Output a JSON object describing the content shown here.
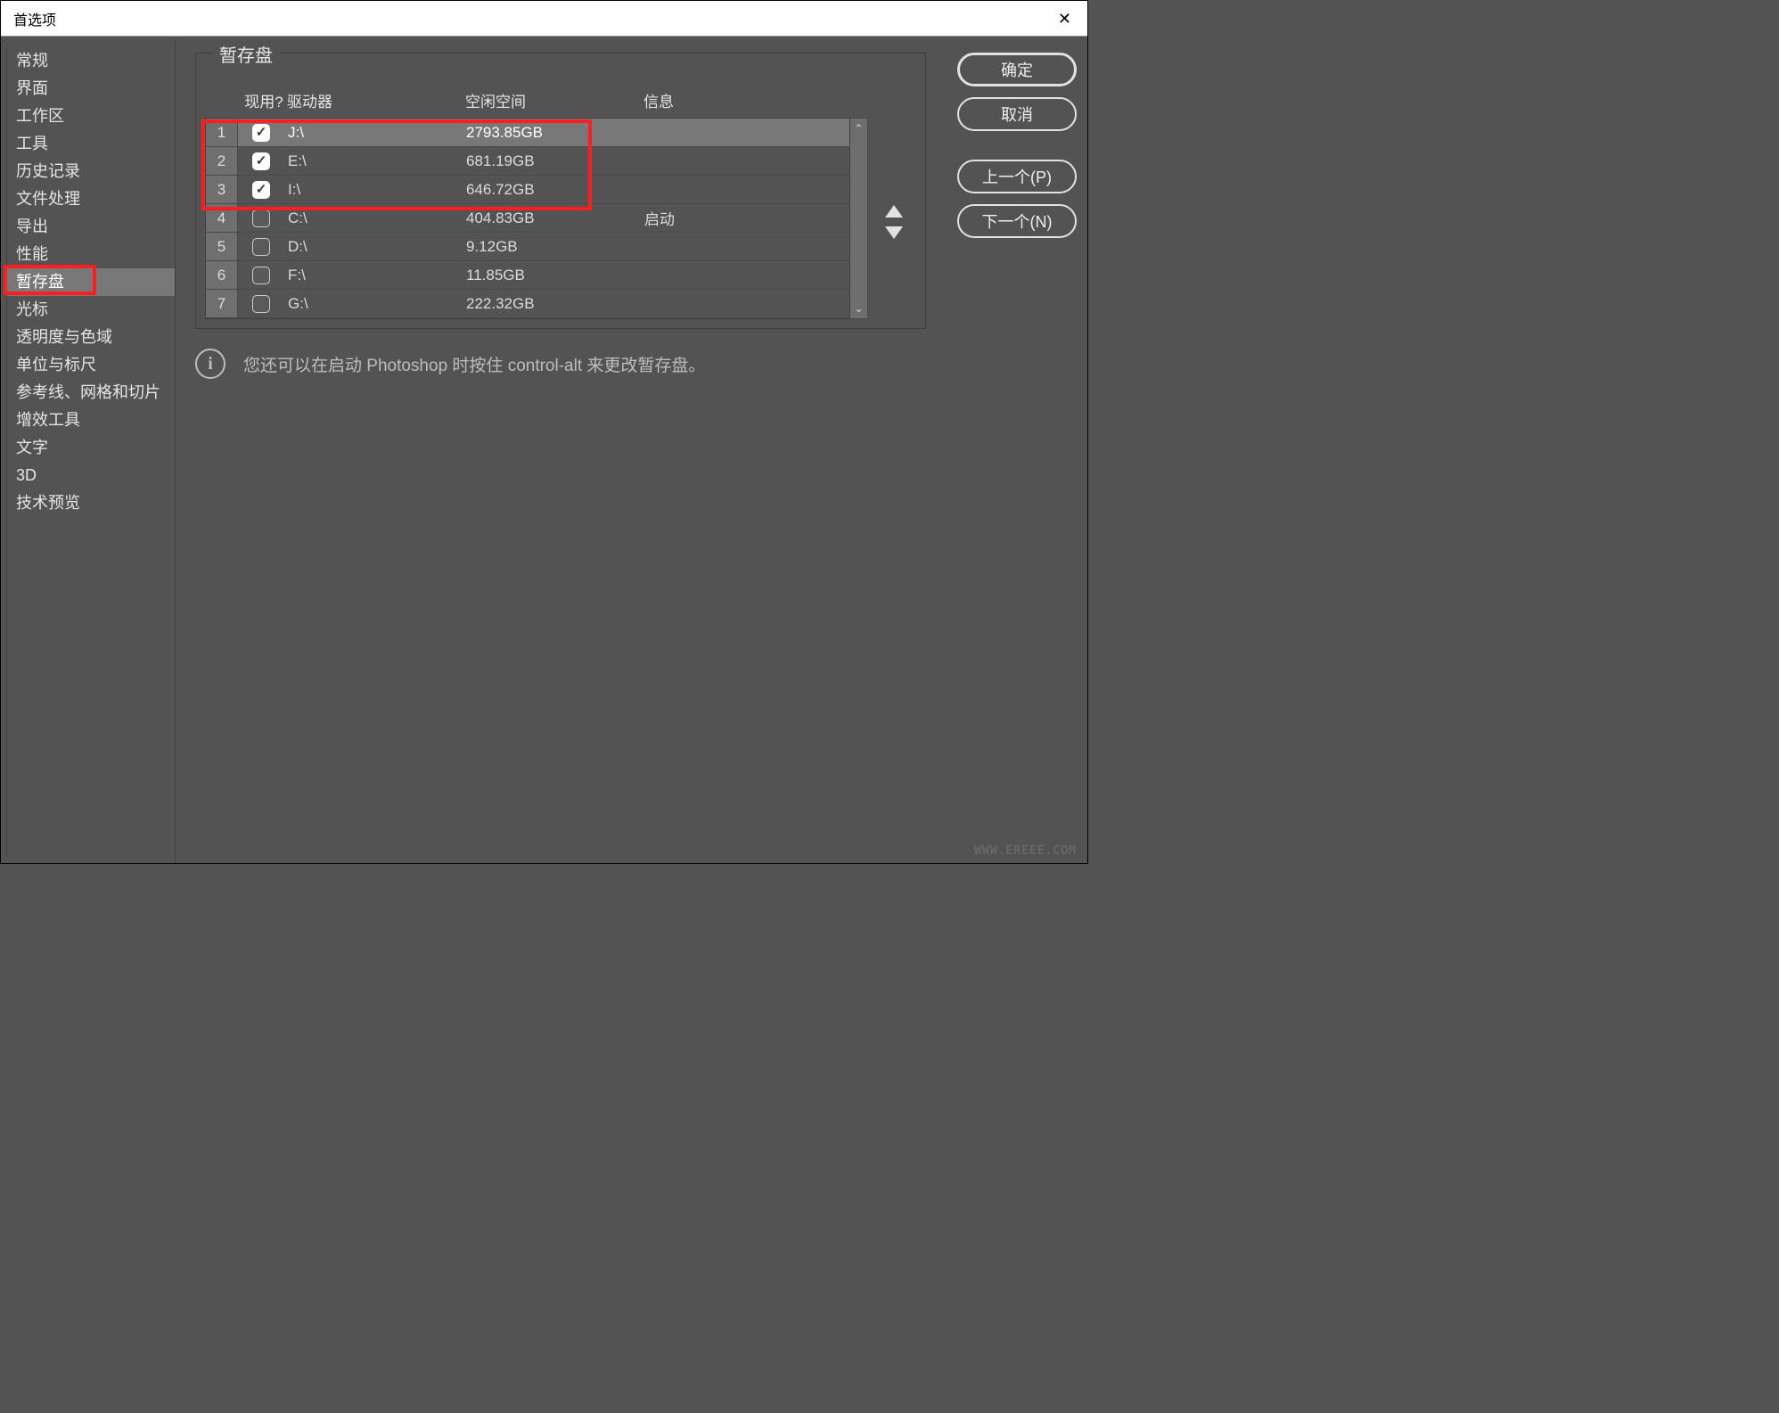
{
  "window": {
    "title": "首选项"
  },
  "sidebar": {
    "items": [
      {
        "label": "常规"
      },
      {
        "label": "界面"
      },
      {
        "label": "工作区"
      },
      {
        "label": "工具"
      },
      {
        "label": "历史记录"
      },
      {
        "label": "文件处理"
      },
      {
        "label": "导出"
      },
      {
        "label": "性能"
      },
      {
        "label": "暂存盘",
        "selected": true
      },
      {
        "label": "光标"
      },
      {
        "label": "透明度与色域"
      },
      {
        "label": "单位与标尺"
      },
      {
        "label": "参考线、网格和切片"
      },
      {
        "label": "增效工具"
      },
      {
        "label": "文字"
      },
      {
        "label": "3D"
      },
      {
        "label": "技术预览"
      }
    ]
  },
  "panel": {
    "title": "暂存盘",
    "columns": {
      "active": "现用?",
      "drive": "驱动器",
      "free": "空闲空间",
      "info": "信息"
    },
    "rows": [
      {
        "num": "1",
        "checked": true,
        "drive": "J:\\",
        "free": "2793.85GB",
        "info": "",
        "selected": true
      },
      {
        "num": "2",
        "checked": true,
        "drive": "E:\\",
        "free": "681.19GB",
        "info": ""
      },
      {
        "num": "3",
        "checked": true,
        "drive": "I:\\",
        "free": "646.72GB",
        "info": ""
      },
      {
        "num": "4",
        "checked": false,
        "drive": "C:\\",
        "free": "404.83GB",
        "info": "启动"
      },
      {
        "num": "5",
        "checked": false,
        "drive": "D:\\",
        "free": "9.12GB",
        "info": ""
      },
      {
        "num": "6",
        "checked": false,
        "drive": "F:\\",
        "free": "11.85GB",
        "info": ""
      },
      {
        "num": "7",
        "checked": false,
        "drive": "G:\\",
        "free": "222.32GB",
        "info": ""
      }
    ],
    "hint": "您还可以在启动 Photoshop 时按住 control-alt 来更改暂存盘。"
  },
  "actions": {
    "ok": "确定",
    "cancel": "取消",
    "prev": "上一个(P)",
    "next": "下一个(N)"
  },
  "watermark": "WWW.EREEE.COM"
}
